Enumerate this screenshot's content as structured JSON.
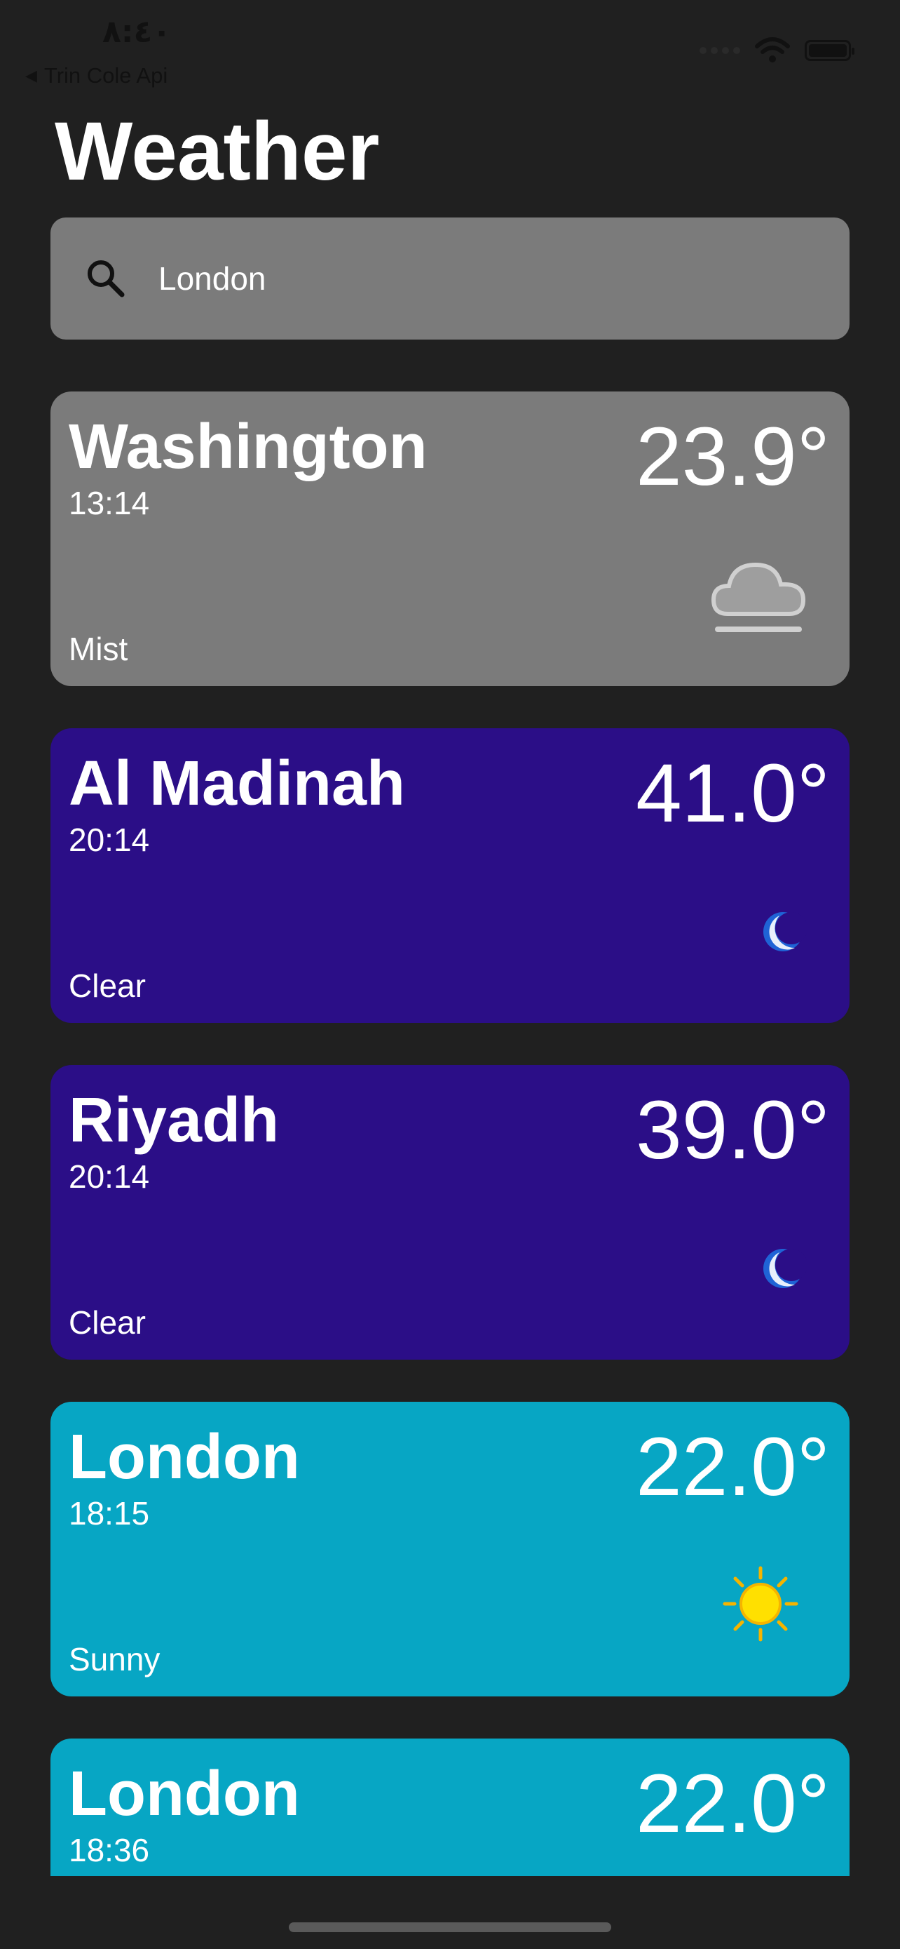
{
  "status_bar": {
    "time": "٨:٤٠",
    "back_label": "Trin Cole Api",
    "back_arrow": "◀"
  },
  "title": "Weather",
  "search": {
    "value": "London",
    "icon": "search-icon"
  },
  "cards": [
    {
      "city": "Washington",
      "time": "13:14",
      "temperature": "23.9°",
      "condition": "Mist",
      "icon": "mist-cloud-icon",
      "color": "#7b7b7b"
    },
    {
      "city": "Al Madinah",
      "time": "20:14",
      "temperature": "41.0°",
      "condition": "Clear",
      "icon": "moon-icon",
      "color": "#2b0e87"
    },
    {
      "city": "Riyadh",
      "time": "20:14",
      "temperature": "39.0°",
      "condition": "Clear",
      "icon": "moon-icon",
      "color": "#2b0e87"
    },
    {
      "city": "London",
      "time": "18:15",
      "temperature": "22.0°",
      "condition": "Sunny",
      "icon": "sun-icon",
      "color": "#07a6c4"
    },
    {
      "city": "London",
      "time": "18:36",
      "temperature": "22.0°",
      "condition": "",
      "icon": "",
      "color": "#07a6c4"
    }
  ]
}
